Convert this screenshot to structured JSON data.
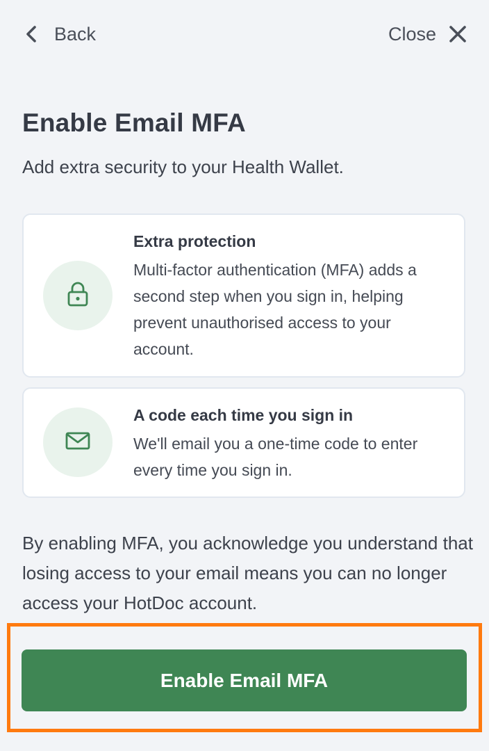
{
  "nav": {
    "back_label": "Back",
    "close_label": "Close"
  },
  "title": "Enable Email MFA",
  "subtitle": "Add extra security to your Health Wallet.",
  "cards": [
    {
      "icon": "lock-icon",
      "heading": "Extra protection",
      "body": "Multi-factor authentication (MFA) adds a second step when you sign in, helping prevent unauthorised access to your account."
    },
    {
      "icon": "mail-icon",
      "heading": "A code each time you sign in",
      "body": "We'll email you a one-time code to enter every time you sign in."
    }
  ],
  "disclaimer": "By enabling MFA, you acknowledge you understand that losing access to your email means you can no longer access your HotDoc account.",
  "cta_label": "Enable Email MFA",
  "colors": {
    "primary_green": "#3f8654",
    "icon_circle_bg": "#e9f3ec",
    "highlight_orange": "#ff7a0f",
    "background": "#f2f4f7"
  }
}
